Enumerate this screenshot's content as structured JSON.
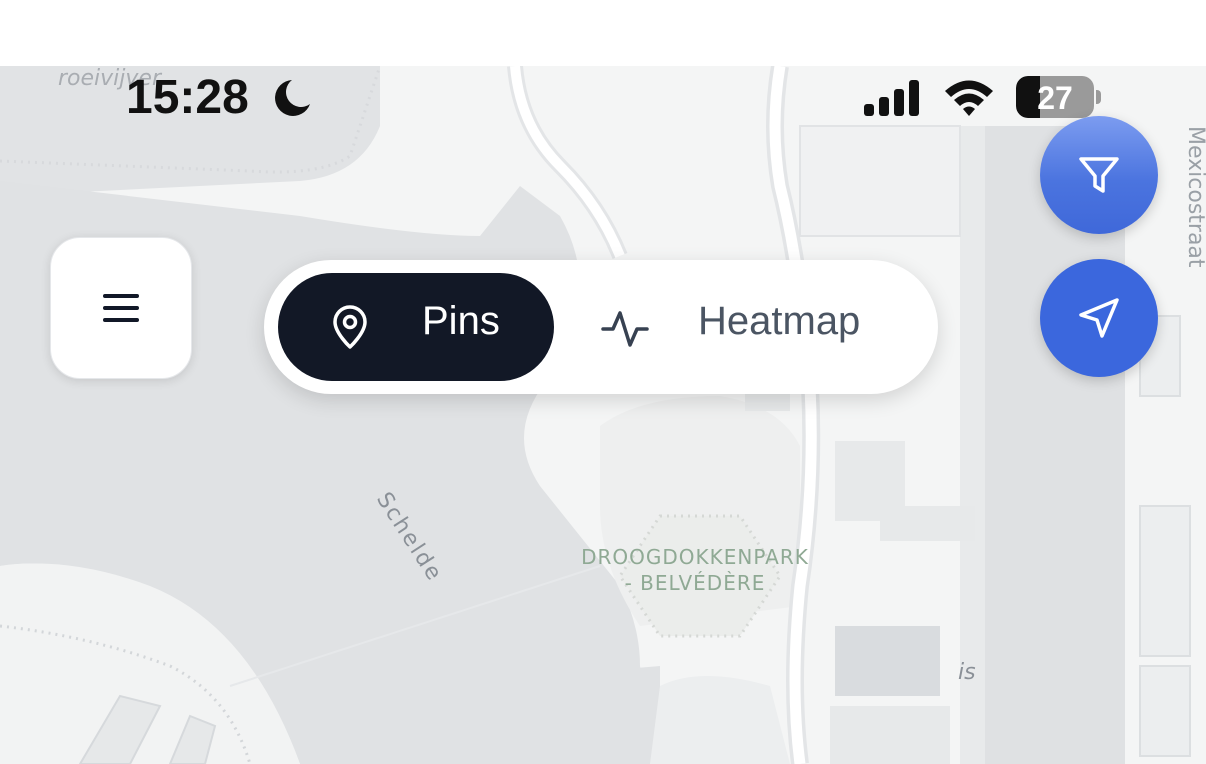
{
  "status_bar": {
    "time": "15:28",
    "battery_percent": "27",
    "icons": [
      "moon-icon",
      "cellular-signal-icon",
      "wifi-icon",
      "battery-icon"
    ]
  },
  "map": {
    "labels": {
      "roeivijver": "roeivijver",
      "schelde": "Schelde",
      "park_line1": "DROOGDOKKENPARK",
      "park_line2": "- BELVÉDÈRE",
      "mexicostraat": "Mexicostraat",
      "is": "is"
    }
  },
  "menu_button": {
    "icon": "hamburger-menu-icon"
  },
  "view_toggle": {
    "selected": "Pins",
    "pins_label": "Pins",
    "heatmap_label": "Heatmap",
    "pins_icon": "map-pin-icon",
    "heatmap_icon": "activity-pulse-icon"
  },
  "fabs": {
    "filter_icon": "filter-icon",
    "locate_icon": "navigation-arrow-icon"
  },
  "colors": {
    "accent": "#3b67dd",
    "toggle_selected_bg": "#121826",
    "map_water": "#dfe1e3",
    "map_land": "#f4f5f5",
    "park_label": "#8fa994"
  }
}
